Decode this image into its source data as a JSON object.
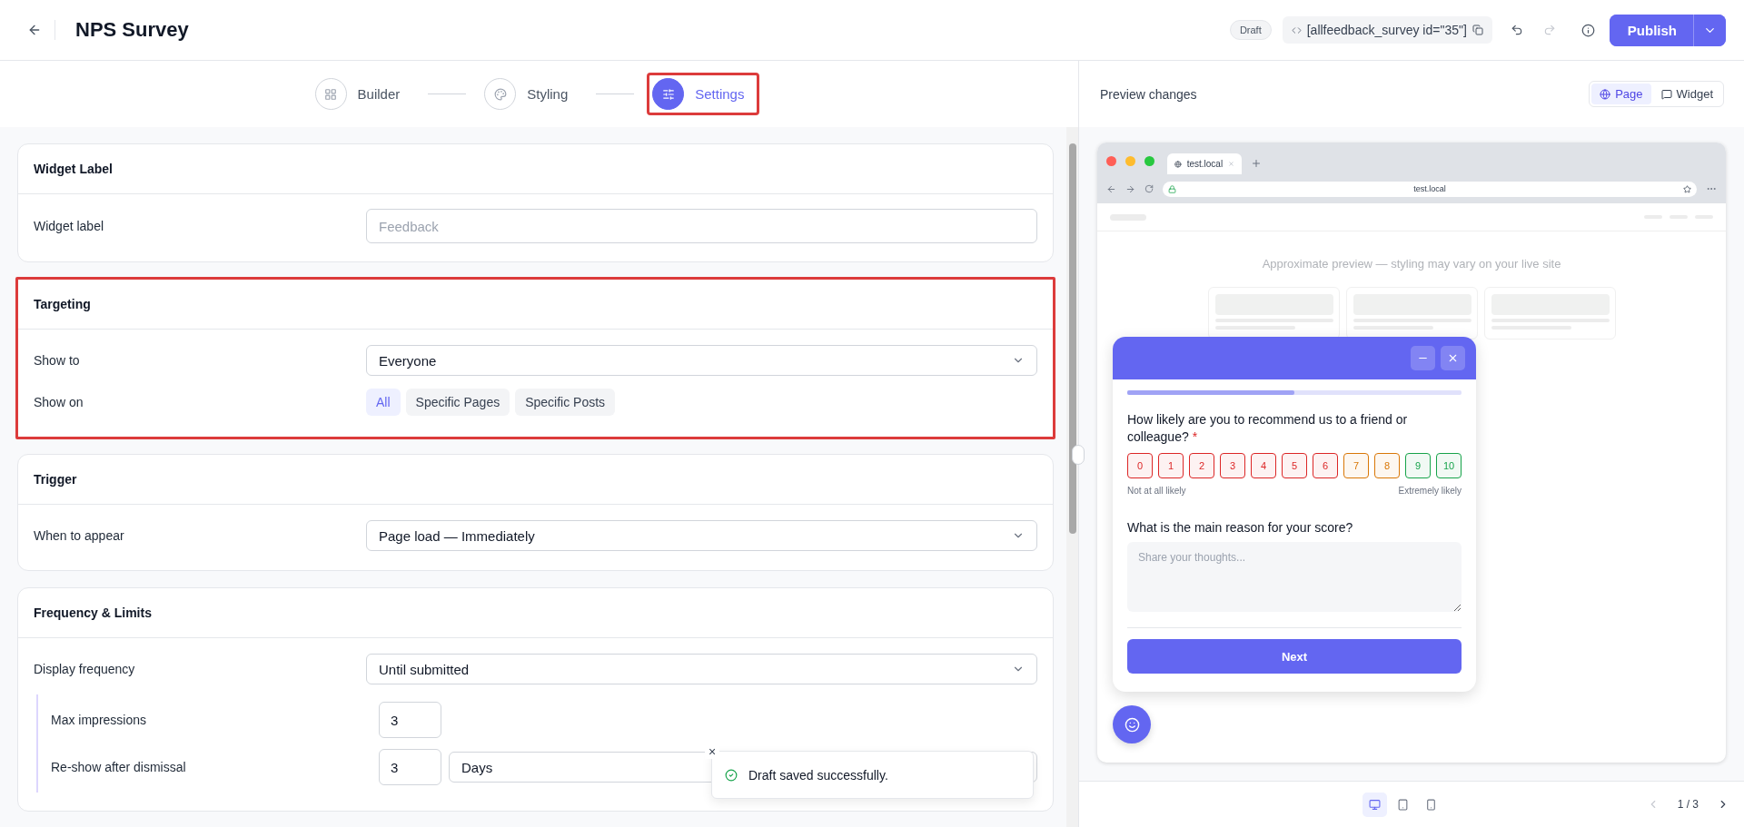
{
  "header": {
    "title": "NPS Survey",
    "status": "Draft",
    "shortcode": "[allfeedback_survey id=\"35\"]",
    "publish": "Publish"
  },
  "steps": [
    {
      "label": "Builder",
      "selected": false,
      "highlighted": false
    },
    {
      "label": "Styling",
      "selected": false,
      "highlighted": false
    },
    {
      "label": "Settings",
      "selected": true,
      "highlighted": true
    }
  ],
  "sections": [
    {
      "title": "Widget Label",
      "highlighted": false,
      "rows": [
        {
          "kind": "input",
          "label": "Widget label",
          "placeholder": "Feedback"
        }
      ]
    },
    {
      "title": "Targeting",
      "highlighted": true,
      "rows": [
        {
          "kind": "select",
          "label": "Show to",
          "value": "Everyone"
        },
        {
          "kind": "segments",
          "label": "Show on",
          "options": [
            {
              "label": "All",
              "selected": true
            },
            {
              "label": "Specific Pages",
              "selected": false
            },
            {
              "label": "Specific Posts",
              "selected": false
            }
          ]
        }
      ]
    },
    {
      "title": "Trigger",
      "highlighted": false,
      "rows": [
        {
          "kind": "select",
          "label": "When to appear",
          "value": "Page load — Immediately"
        }
      ]
    },
    {
      "title": "Frequency & Limits",
      "highlighted": false,
      "rows": [
        {
          "kind": "select",
          "label": "Display frequency",
          "value": "Until submitted"
        },
        {
          "kind": "group",
          "rows": [
            {
              "kind": "number",
              "label": "Max impressions",
              "value": "3"
            },
            {
              "kind": "number-select",
              "label": "Re-show after dismissal",
              "value": "3",
              "unit": "Days"
            }
          ]
        }
      ]
    }
  ],
  "toast": {
    "message": "Draft saved successfully.",
    "close": "×"
  },
  "preview": {
    "title": "Preview changes",
    "views": [
      {
        "label": "Page",
        "selected": true
      },
      {
        "label": "Widget",
        "selected": false
      }
    ],
    "browser": {
      "tab": "test.local",
      "url": "test.local",
      "note": "Approximate preview — styling may vary on your live site"
    },
    "survey": {
      "level": 0.5,
      "question": "How likely are you to recommend us to a friend or colleague?",
      "required_mark": "*",
      "scale": [
        {
          "label": "0",
          "color": "#dc2626"
        },
        {
          "label": "1",
          "color": "#dc2626"
        },
        {
          "label": "2",
          "color": "#dc2626"
        },
        {
          "label": "3",
          "color": "#dc2626"
        },
        {
          "label": "4",
          "color": "#dc2626"
        },
        {
          "label": "5",
          "color": "#dc2626"
        },
        {
          "label": "6",
          "color": "#dc2626"
        },
        {
          "label": "7",
          "color": "#d97706"
        },
        {
          "label": "8",
          "color": "#d97706"
        },
        {
          "label": "9",
          "color": "#16a34a"
        },
        {
          "label": "10",
          "color": "#16a34a"
        }
      ],
      "low_label": "Not at all likely",
      "high_label": "Extremely likely",
      "question2": "What is the main reason for your score?",
      "placeholder": "Share your thoughts...",
      "button": "Next"
    },
    "devices": [
      {
        "kind": "desktop",
        "selected": true
      },
      {
        "kind": "tablet",
        "selected": false
      },
      {
        "kind": "phone",
        "selected": false
      }
    ],
    "pager": "1 / 3"
  }
}
